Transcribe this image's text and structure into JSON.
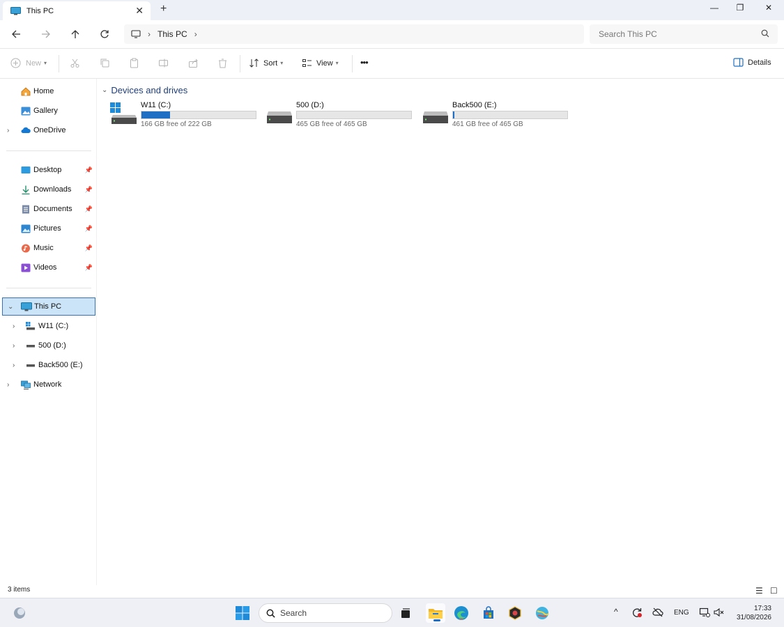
{
  "window": {
    "tab_title": "This PC",
    "new_tab": "+",
    "close_tab": "✕",
    "controls": {
      "minimize": "—",
      "maximize": "❐",
      "close": "✕"
    }
  },
  "addressbar": {
    "breadcrumb": [
      "This PC"
    ],
    "search_placeholder": "Search This PC"
  },
  "toolbar": {
    "new_label": "New",
    "sort_label": "Sort",
    "view_label": "View",
    "more_label": "•••",
    "details_label": "Details"
  },
  "sidebar": {
    "quick": [
      {
        "label": "Home",
        "icon": "home-icon"
      },
      {
        "label": "Gallery",
        "icon": "gallery-icon"
      },
      {
        "label": "OneDrive",
        "icon": "onedrive-icon"
      }
    ],
    "pinned": [
      {
        "label": "Desktop",
        "icon": "desktop-icon"
      },
      {
        "label": "Downloads",
        "icon": "downloads-icon"
      },
      {
        "label": "Documents",
        "icon": "documents-icon"
      },
      {
        "label": "Pictures",
        "icon": "pictures-icon"
      },
      {
        "label": "Music",
        "icon": "music-icon"
      },
      {
        "label": "Videos",
        "icon": "videos-icon"
      }
    ],
    "tree": [
      {
        "label": "This PC",
        "icon": "this-pc-icon",
        "expanded": true,
        "selected": true
      },
      {
        "label": "W11 (C:)",
        "icon": "system-drive-icon"
      },
      {
        "label": "500 (D:)",
        "icon": "drive-icon"
      },
      {
        "label": "Back500 (E:)",
        "icon": "drive-icon"
      },
      {
        "label": "Network",
        "icon": "network-icon"
      }
    ]
  },
  "content": {
    "group_label": "Devices and drives",
    "drives": [
      {
        "name": "W11 (C:)",
        "free_text": "166 GB free of 222 GB",
        "used_fraction": 0.25,
        "system": true
      },
      {
        "name": "500 (D:)",
        "free_text": "465 GB free of 465 GB",
        "used_fraction": 0.0,
        "system": false
      },
      {
        "name": "Back500 (E:)",
        "free_text": "461 GB free of 465 GB",
        "used_fraction": 0.01,
        "system": false
      }
    ]
  },
  "statusbar": {
    "items_count": "3 items"
  },
  "taskbar": {
    "search_placeholder": "Search",
    "language": "ENG",
    "time": "17:33",
    "date": "31/08/2026"
  },
  "colors": {
    "accent": "#1f6fc5",
    "selection": "#cce4f7",
    "selection_border": "#3a70b8",
    "group_heading": "#1f3d7a"
  }
}
